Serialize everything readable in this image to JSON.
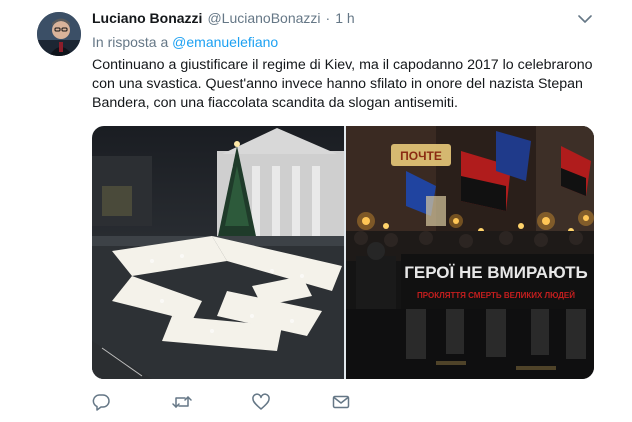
{
  "tweet": {
    "author_name": "Luciano Bonazzi",
    "author_handle": "@LucianoBonazzi",
    "separator": "·",
    "time": "1 h",
    "reply_prefix": "In risposta a",
    "reply_to": "@emanuelefiano",
    "text_lines": [
      "Continuano a giustificare il regime di Kiev, ma il capodanno 2017 lo celebrarono",
      "con una svastica. Quest'anno invece hanno sfilato in onore del nazista Stepan",
      "Bandera, con una fiaccolata scandita da slogan antisemiti."
    ],
    "photos": [
      {
        "icon": "square-crowd-photo"
      },
      {
        "icon": "torch-march-photo",
        "sign_text": "ПОЧТЕ",
        "banner_text": "ГЕРОЇ НЕ ВМИРАЮТЬ",
        "banner_subtext": "ПРОКЛЯТТЯ СМЕРТЬ ВЕЛИКИХ ЛЮДЕЙ"
      }
    ],
    "actions": [
      {
        "name": "reply",
        "icon": "reply-icon"
      },
      {
        "name": "retweet",
        "icon": "retweet-icon"
      },
      {
        "name": "like",
        "icon": "heart-icon"
      },
      {
        "name": "message",
        "icon": "envelope-icon"
      }
    ]
  },
  "colors": {
    "text": "#14171a",
    "secondary": "#657786",
    "link": "#1da1f2",
    "icon": "#657786"
  }
}
